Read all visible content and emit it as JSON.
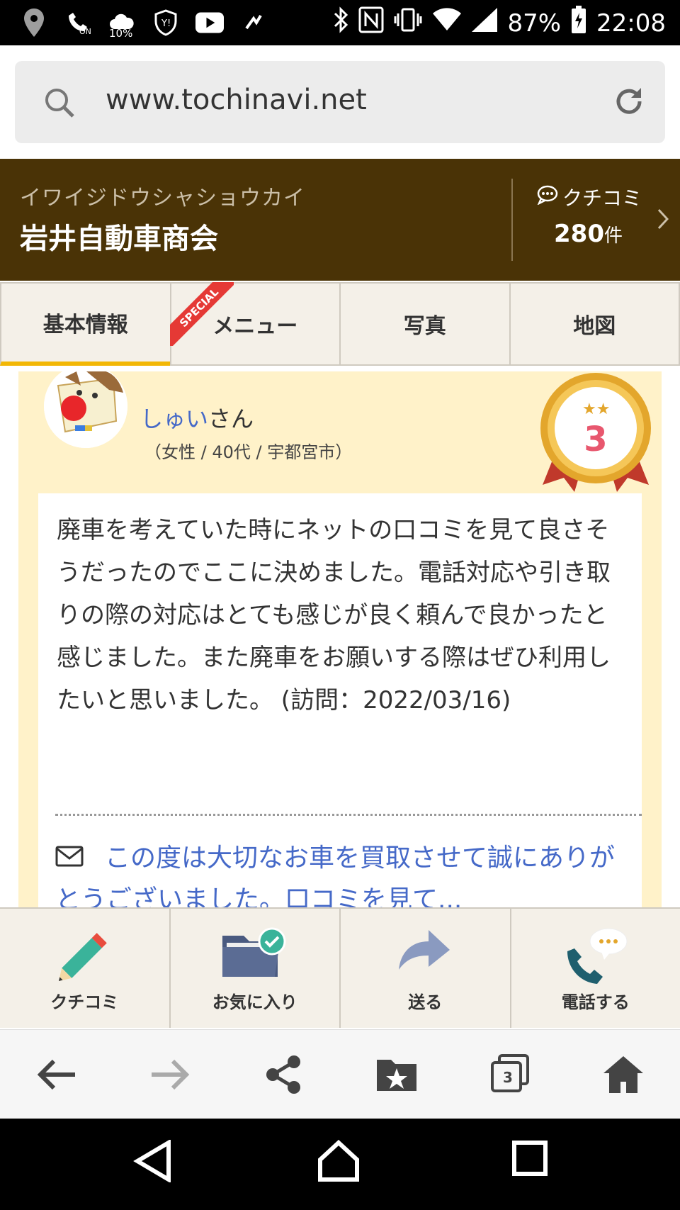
{
  "status_bar": {
    "temperature_label": "10%",
    "on_label": "ON",
    "battery": "87%",
    "time": "22:08"
  },
  "browser": {
    "url": "www.tochinavi.net",
    "tab_count": "3"
  },
  "shop": {
    "kana": "イワイジドウシャショウカイ",
    "name": "岩井自動車商会",
    "kuchikomi_label": "クチコミ",
    "kuchikomi_count": "280",
    "kuchikomi_unit": "件"
  },
  "tabs": [
    {
      "label": "基本情報",
      "active": true
    },
    {
      "label": "メニュー",
      "badge": "SPECIAL"
    },
    {
      "label": "写真"
    },
    {
      "label": "地図"
    }
  ],
  "review": {
    "username": "しゅい",
    "honorific": "さん",
    "user_info": "（女性 / 40代 / 宇都宮市）",
    "rank": "3",
    "body": "廃車を考えていた時にネットの口コミを見て良さそうだったのでここに決めました。電話対応や引き取りの際の対応はとても感じが良く頼んで良かったと感じました。また廃車をお願いする際はぜひ利用したいと思いました。 (訪問：2022/03/16)",
    "reply": "この度は大切なお車を買取させて誠にありがとうございました。口コミを見て..."
  },
  "actions": [
    {
      "label": "クチコミ",
      "icon": "pencil-icon"
    },
    {
      "label": "お気に入り",
      "icon": "folder-check-icon"
    },
    {
      "label": "送る",
      "icon": "share-arrow-icon"
    },
    {
      "label": "電話する",
      "icon": "phone-icon"
    }
  ],
  "colors": {
    "header_bg": "#4a3306",
    "accent_yellow": "#f2b705",
    "review_bg": "#fff2c9",
    "link_blue": "#4569c8",
    "rank_pink": "#e8576e"
  }
}
